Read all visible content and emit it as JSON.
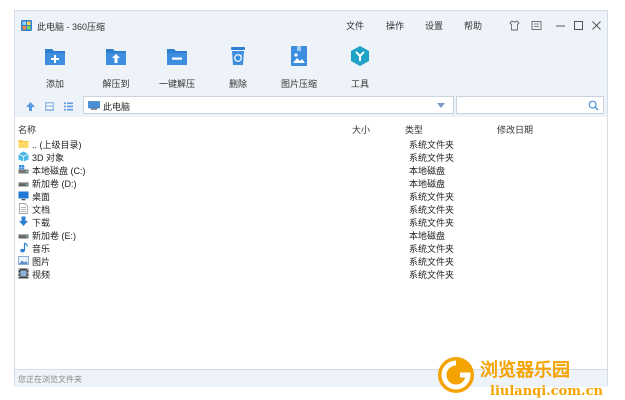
{
  "app": {
    "title": "此电脑 - 360压缩"
  },
  "menu": [
    {
      "label": "文件"
    },
    {
      "label": "操作"
    },
    {
      "label": "设置"
    },
    {
      "label": "帮助"
    }
  ],
  "toolbar": [
    {
      "label": "添加",
      "icon": "add-icon"
    },
    {
      "label": "解压到",
      "icon": "extract-to-icon"
    },
    {
      "label": "一键解压",
      "icon": "one-click-extract-icon"
    },
    {
      "label": "删除",
      "icon": "delete-icon"
    },
    {
      "label": "图片压缩",
      "icon": "image-compress-icon"
    },
    {
      "label": "工具",
      "icon": "tools-icon"
    }
  ],
  "address": {
    "value": "此电脑"
  },
  "columns": {
    "name": "名称",
    "size": "大小",
    "type": "类型",
    "modified": "修改日期"
  },
  "files": [
    {
      "name": ".. (上级目录)",
      "type": "系统文件夹",
      "icon": "folder-icon"
    },
    {
      "name": "3D 对象",
      "type": "系统文件夹",
      "icon": "3d-objects-icon"
    },
    {
      "name": "本地磁盘 (C:)",
      "type": "本地磁盘",
      "icon": "system-drive-icon"
    },
    {
      "name": "新加卷 (D:)",
      "type": "本地磁盘",
      "icon": "drive-icon"
    },
    {
      "name": "桌面",
      "type": "系统文件夹",
      "icon": "desktop-icon"
    },
    {
      "name": "文档",
      "type": "系统文件夹",
      "icon": "documents-icon"
    },
    {
      "name": "下载",
      "type": "系统文件夹",
      "icon": "downloads-icon"
    },
    {
      "name": "新加卷 (E:)",
      "type": "本地磁盘",
      "icon": "drive-icon"
    },
    {
      "name": "音乐",
      "type": "系统文件夹",
      "icon": "music-icon"
    },
    {
      "name": "图片",
      "type": "系统文件夹",
      "icon": "pictures-icon"
    },
    {
      "name": "视频",
      "type": "系统文件夹",
      "icon": "videos-icon"
    }
  ],
  "status": {
    "text": "您正在浏览文件夹"
  },
  "watermark": {
    "cn": "浏览器乐园",
    "url": "liulanqi.com.cn"
  },
  "colors": {
    "accent": "#2f7fd0",
    "chrome": "#eef3f9",
    "watermark": "#f5a300"
  }
}
